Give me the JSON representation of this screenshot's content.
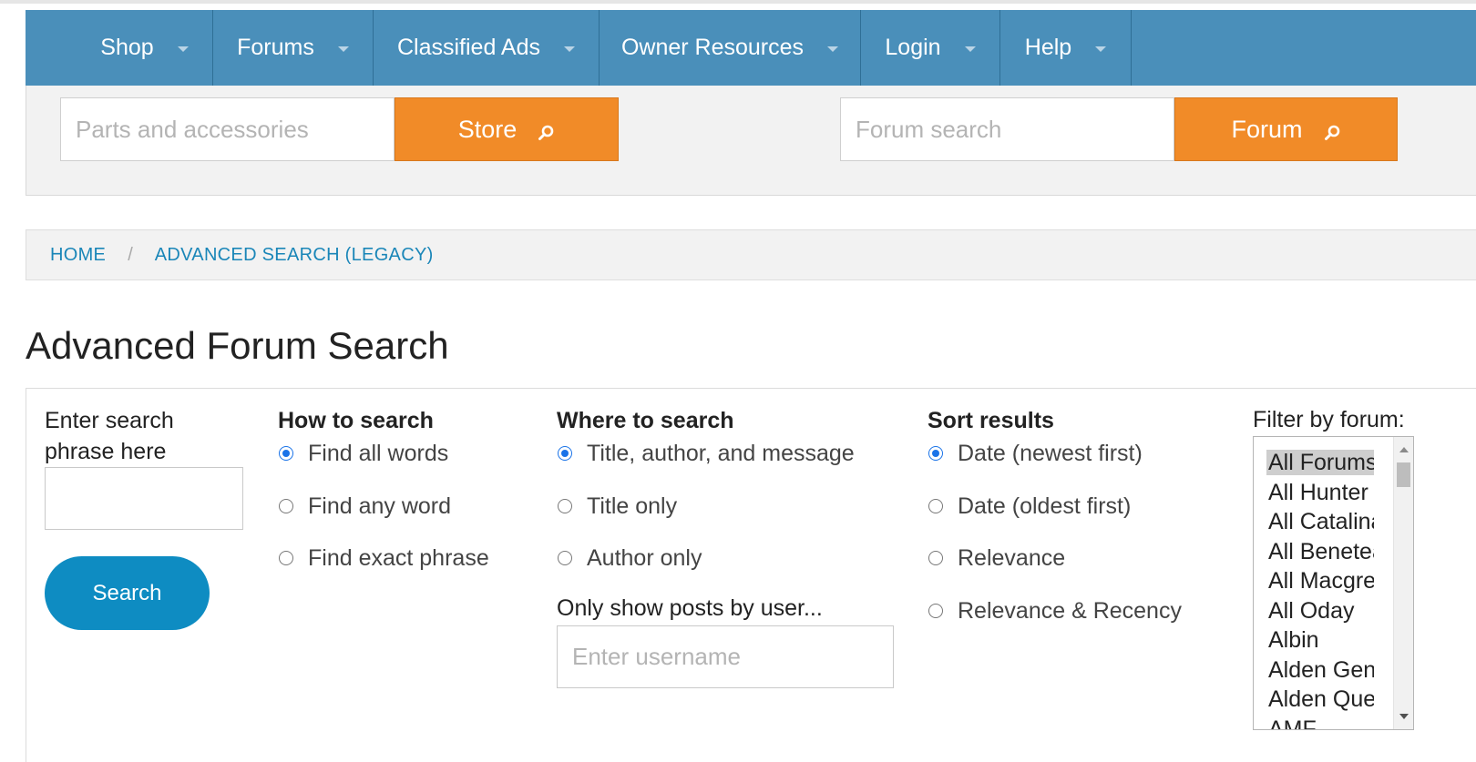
{
  "nav": {
    "items": [
      {
        "label": "Shop"
      },
      {
        "label": "Forums"
      },
      {
        "label": "Classified Ads"
      },
      {
        "label": "Owner Resources"
      },
      {
        "label": "Login"
      },
      {
        "label": "Help"
      }
    ]
  },
  "store_search": {
    "placeholder": "Parts and accessories",
    "button": "Store"
  },
  "forum_search": {
    "placeholder": "Forum search",
    "button": "Forum"
  },
  "breadcrumb": {
    "home": "HOME",
    "separator": "/",
    "current": "ADVANCED SEARCH (LEGACY)"
  },
  "page_title": "Advanced Forum Search",
  "form": {
    "phrase_label": "Enter search phrase here",
    "phrase_value": "",
    "search_button": "Search",
    "how": {
      "heading": "How to search",
      "options": [
        "Find all words",
        "Find any word",
        "Find exact phrase"
      ],
      "selected": 0
    },
    "where": {
      "heading": "Where to search",
      "options": [
        "Title, author, and message",
        "Title only",
        "Author only"
      ],
      "selected": 0
    },
    "user_filter": {
      "label": "Only show posts by user...",
      "placeholder": "Enter username"
    },
    "sort": {
      "heading": "Sort results",
      "options": [
        "Date (newest first)",
        "Date (oldest first)",
        "Relevance",
        "Relevance & Recency"
      ],
      "selected": 0
    },
    "forum_filter": {
      "label": "Filter by forum:",
      "options": [
        "All Forums",
        "All Hunter",
        "All Catalina",
        "All Beneteau",
        "All Macgregor",
        "All Oday",
        "Albin",
        "Alden General",
        "Alden Questions",
        "AMF"
      ],
      "selected": 0
    }
  },
  "colors": {
    "nav_bg": "#4a8fba",
    "orange": "#f18b28",
    "link": "#1a86b8",
    "search_button": "#0e8cc2"
  }
}
